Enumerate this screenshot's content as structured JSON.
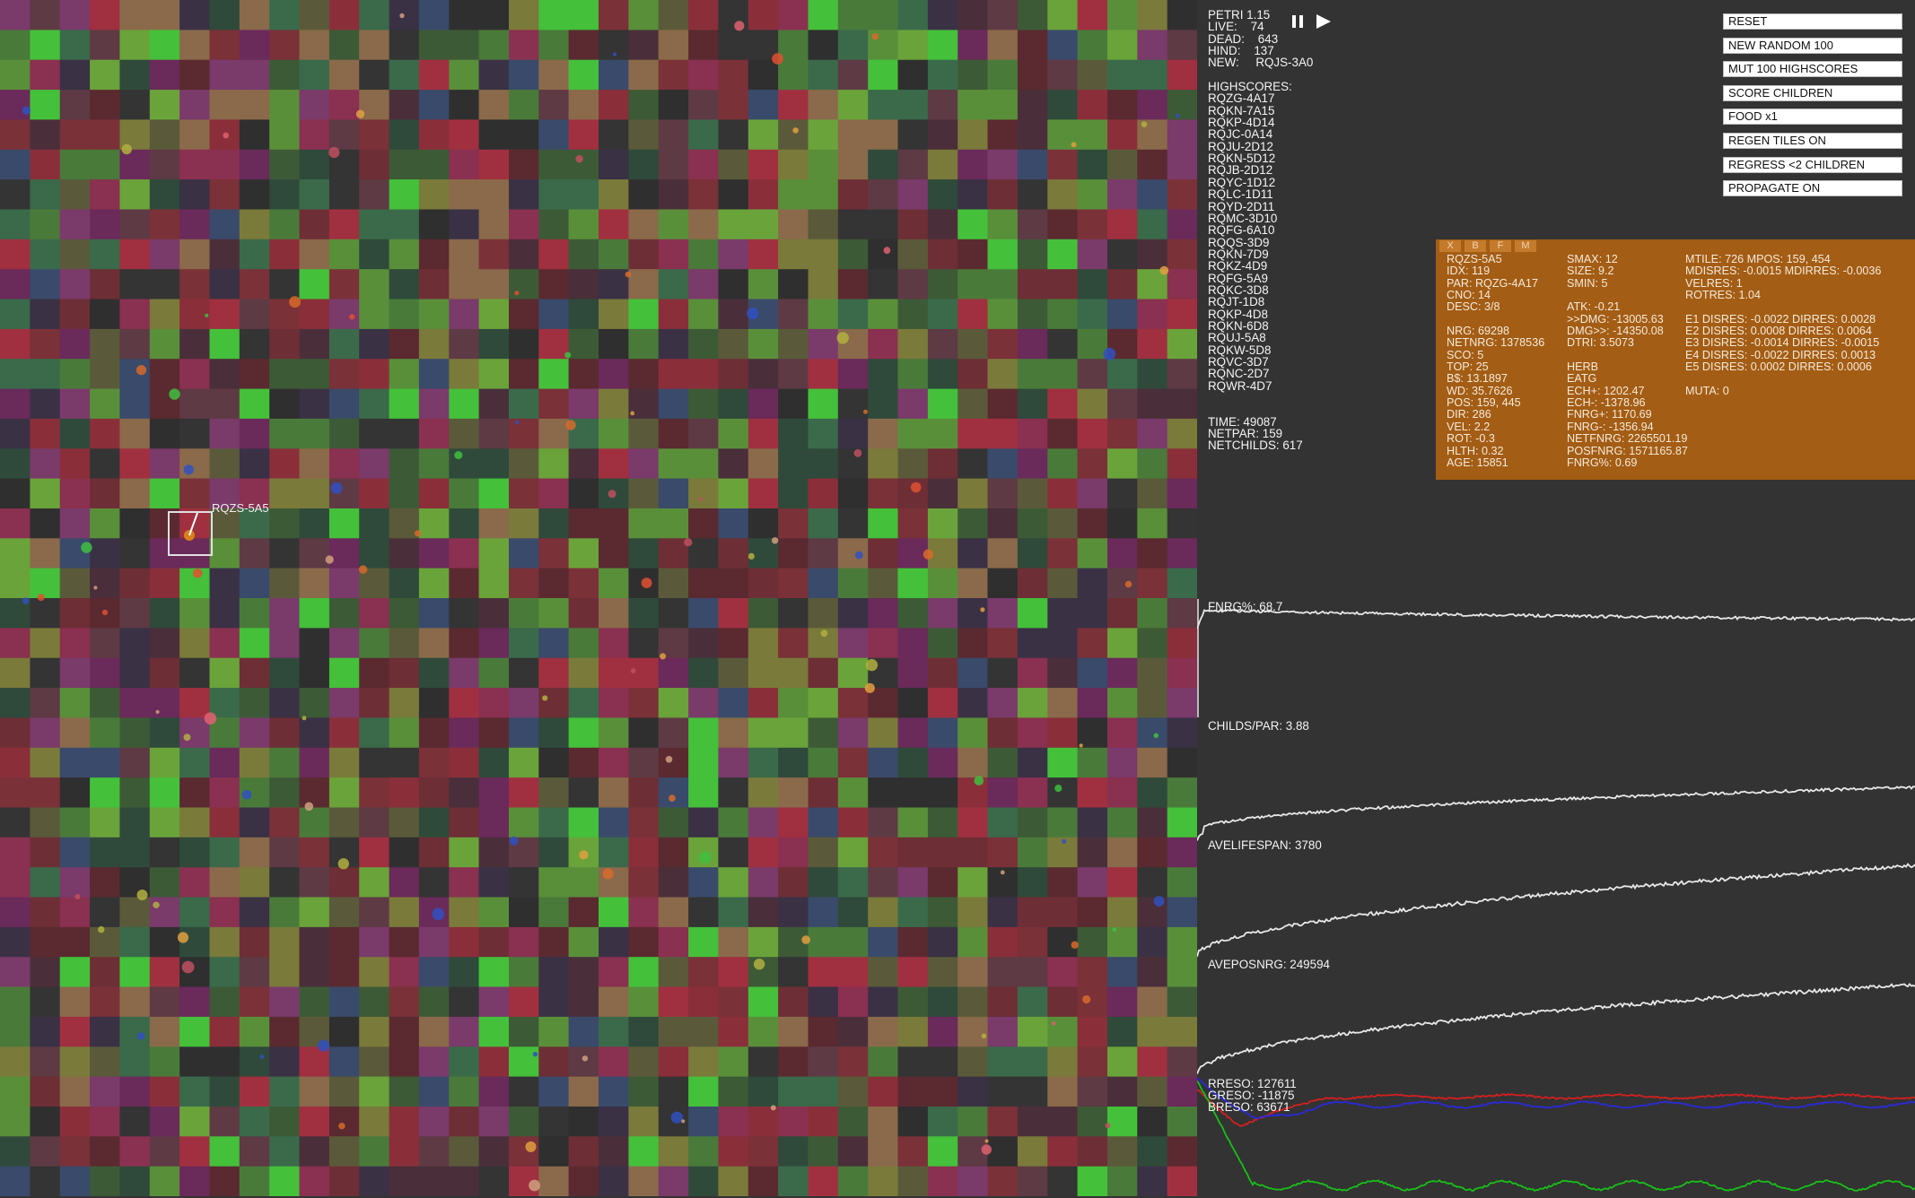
{
  "app": {
    "title": "PETRI 1.15"
  },
  "stats": {
    "live": "LIVE:    74",
    "dead": "DEAD:    643",
    "hind": "HIND:    137",
    "new": "NEW:     RQJS-3A0"
  },
  "controls": {
    "pause_icon": "pause-icon",
    "play_icon": "play-icon"
  },
  "highscores": {
    "heading": "HIGHSCORES:",
    "items": [
      "RQZG-4A17",
      "RQKN-7A15",
      "RQKP-4D14",
      "RQJC-0A14",
      "RQJU-2D12",
      "RQKN-5D12",
      "RQJB-2D12",
      "RQYC-1D12",
      "RQLC-1D11",
      "RQYD-2D11",
      "RQMC-3D10",
      "RQFG-6A10",
      "RQQS-3D9",
      "RQKN-7D9",
      "RQKZ-4D9",
      "RQFG-5A9",
      "RQKC-3D8",
      "RQJT-1D8",
      "RQKP-4D8",
      "RQKN-6D8",
      "RQUJ-5A8",
      "RQKW-5D8",
      "RQVC-3D7",
      "RQNC-2D7",
      "RQWR-4D7"
    ]
  },
  "totals": {
    "time": "TIME: 49087",
    "netpar": "NETPAR: 159",
    "netchilds": "NETCHILDS: 617"
  },
  "buttons": {
    "reset": "RESET",
    "new_random": "NEW RANDOM 100",
    "mut_highscores": "MUT 100 HIGHSCORES",
    "score_children": "SCORE CHILDREN",
    "food": "FOOD x1",
    "regen_tiles": "REGEN TILES ON",
    "regress": "REGRESS <2 CHILDREN",
    "propagate": "PROPAGATE ON"
  },
  "info_panel": {
    "tabs": [
      "X",
      "B",
      "F",
      "M"
    ],
    "col1": "RQZS-5A5\nIDX: 119\nPAR: RQZG-4A17\nCNO: 14\nDESC: 3/8\n\nNRG: 69298\nNETNRG: 1378536\nSCO: 5\nTOP: 25\nB$: 13.1897\nWD: 35.7626\nPOS: 159, 445\nDIR: 286\nVEL: 2.2\nROT: -0.3\nHLTH: 0.32\nAGE: 15851",
    "col2": "SMAX: 12\nSIZE: 9.2\nSMIN: 5\n\nATK: -0.21\n>>DMG: -13005.63\nDMG>>: -14350.08\nDTRI: 3.5073\n\nHERB\nEATG\nECH+: 1202.47\nECH-: -1378.96\nFNRG+: 1170.69\nFNRG-: -1356.94\nNETFNRG: 2265501.19\nPOSFNRG: 1571165.87\nFNRG%: 0.69",
    "col3": "MTILE: 726 MPOS: 159, 454\nMDISRES: -0.0015 MDIRRES: -0.0036\nVELRES: 1\nROTRES: 1.04\n\nE1 DISRES: -0.0022 DIRRES: 0.0028\nE2 DISRES: 0.0008 DIRRES: 0.0064\nE3 DISRES: -0.0014 DIRRES: -0.0015\nE4 DISRES: -0.0022 DIRRES: 0.0013\nE5 DISRES: 0.0002 DIRRES: 0.0006\n\nMUTA: 0"
  },
  "graph_labels": {
    "fnrg": "FNRG%: 68.7",
    "childs_par": "CHILDS/PAR: 3.88",
    "avelifespan": "AVELIFESPAN: 3780",
    "aveposnrg": "AVEPOSNRG: 249594",
    "rreso": "RRESO: 127611",
    "greso": "GRESO: -11875",
    "breso": "BRESO: 63671"
  },
  "world": {
    "selected_cell_label": "RQZS-5A5"
  },
  "colors": {
    "background": "#333333",
    "info_panel": "#a35d14",
    "rreso": "#d42020",
    "greso": "#18c018",
    "breso": "#2a2ad8",
    "graph_line": "#e8e8e8"
  }
}
